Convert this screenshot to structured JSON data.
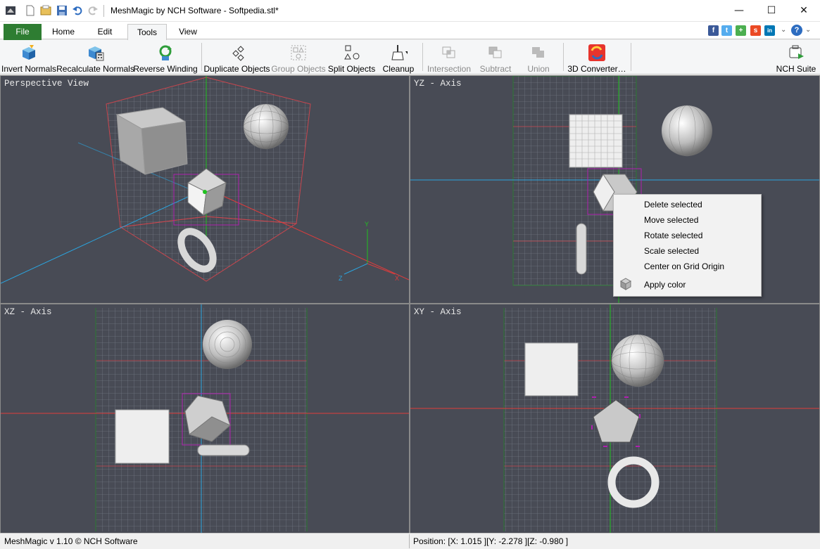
{
  "window": {
    "title": "MeshMagic by NCH Software - Softpedia.stl*",
    "controls": {
      "minimize": "—",
      "maximize": "☐",
      "close": "✕"
    }
  },
  "quick_access": [
    "app-icon",
    "new-file-icon",
    "open-file-icon",
    "save-icon",
    "undo-icon",
    "redo-icon"
  ],
  "tabs": [
    {
      "label": "File",
      "active": false
    },
    {
      "label": "Home",
      "active": false
    },
    {
      "label": "Edit",
      "active": false
    },
    {
      "label": "Tools",
      "active": true
    },
    {
      "label": "View",
      "active": false
    }
  ],
  "social": [
    {
      "icon": "facebook-icon",
      "glyph": "f",
      "color": "#3b5998"
    },
    {
      "icon": "twitter-icon",
      "glyph": "t",
      "color": "#55acee"
    },
    {
      "icon": "google-plus-icon",
      "glyph": "+",
      "color": "#4caf50"
    },
    {
      "icon": "stumbleupon-icon",
      "glyph": "s",
      "color": "#eb4924"
    },
    {
      "icon": "linkedin-icon",
      "glyph": "in",
      "color": "#0077b5"
    }
  ],
  "toolbar": {
    "invert_normals": "Invert Normals",
    "recalculate_normals": "Recalculate Normals",
    "reverse_winding": "Reverse Winding",
    "duplicate_objects": "Duplicate Objects",
    "group_objects": "Group Objects",
    "split_objects": "Split Objects",
    "cleanup": "Cleanup",
    "intersection": "Intersection",
    "subtract": "Subtract",
    "union": "Union",
    "converter": "3D Converter…",
    "nch_suite": "NCH Suite"
  },
  "viewports": {
    "perspective": "Perspective View",
    "yz": "YZ - Axis",
    "xz": "XZ - Axis",
    "xy": "XY - Axis"
  },
  "axis_labels": {
    "x": "X",
    "y": "Y",
    "z": "Z"
  },
  "context_menu": {
    "items": [
      "Delete selected",
      "Move selected",
      "Rotate selected",
      "Scale selected",
      "Center on Grid Origin",
      "Apply color"
    ]
  },
  "status": {
    "version": "MeshMagic v 1.10 © NCH Software",
    "position": "Position: [X: 1.015 ][Y: -2.278 ][Z: -0.980 ]"
  },
  "colors": {
    "file_tab": "#2e7d32",
    "viewport_bg": "#484b55",
    "grid": "#7d8590",
    "axis_red": "#e03c3c",
    "axis_green": "#1fc21f",
    "axis_blue": "#2aa5e0",
    "selection": "#b020b0"
  }
}
